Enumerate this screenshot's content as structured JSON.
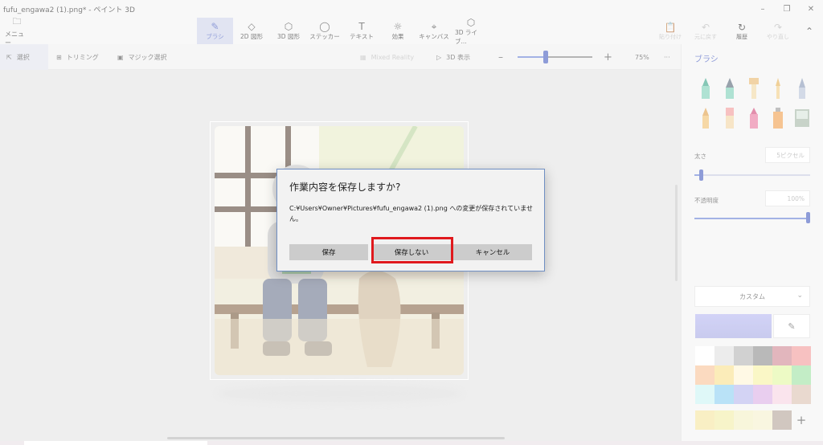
{
  "window": {
    "title": "fufu_engawa2 (1).png* - ペイント 3D"
  },
  "ribbon": {
    "menu_label": "メニュー",
    "tools": [
      {
        "label": "ブラシ",
        "icon": "brush-icon",
        "active": true
      },
      {
        "label": "2D 図形",
        "icon": "2d-shapes-icon"
      },
      {
        "label": "3D 図形",
        "icon": "3d-shapes-icon"
      },
      {
        "label": "ステッカー",
        "icon": "sticker-icon"
      },
      {
        "label": "テキスト",
        "icon": "text-icon"
      },
      {
        "label": "効果",
        "icon": "effects-icon"
      },
      {
        "label": "キャンバス",
        "icon": "canvas-icon"
      },
      {
        "label": "3D ライブ...",
        "icon": "3d-library-icon"
      }
    ],
    "right": [
      {
        "label": "貼り付け",
        "icon": "paste-icon",
        "dim": true
      },
      {
        "label": "元に戻す",
        "icon": "undo-icon",
        "dim": true
      },
      {
        "label": "履歴",
        "icon": "history-icon",
        "dim": false
      },
      {
        "label": "やり直し",
        "icon": "redo-icon",
        "dim": true
      }
    ]
  },
  "toolbar": {
    "select": "選択",
    "crop": "トリミング",
    "magic_select": "マジック選択",
    "mixed_reality": "Mixed Reality",
    "view_3d": "3D 表示",
    "zoom": "75%",
    "more": "···",
    "zoom_percent": 40
  },
  "panel": {
    "title": "ブラシ",
    "thickness_label": "太さ",
    "thickness_value": "5ピクセル",
    "opacity_label": "不透明度",
    "opacity_value": "100%",
    "color_mode": "カスタム",
    "current_color": "#b3b6f0",
    "palette": [
      "#ffffff",
      "#e0e0e0",
      "#b5b5b5",
      "#8f8f8f",
      "#d08a95",
      "#f29c9c",
      "#f8c39a",
      "#f8e18f",
      "#fff5d6",
      "#f7f3a3",
      "#e3f7a2",
      "#9ee3a4",
      "#ccf4f4",
      "#8fd0f2",
      "#b8b8ee",
      "#dcb0e6",
      "#f7d3e3",
      "#dcc2b2"
    ],
    "recent": [
      "#f6e6a1",
      "#f2eda8",
      "#f4f1c6",
      "#f6f0cd",
      "#b5a59a"
    ]
  },
  "dialog": {
    "title": "作業内容を保存しますか?",
    "message": "C:¥Users¥Owner¥Pictures¥fufu_engawa2 (1).png への変更が保存されていません。",
    "save": "保存",
    "dont_save": "保存しない",
    "cancel": "キャンセル"
  }
}
